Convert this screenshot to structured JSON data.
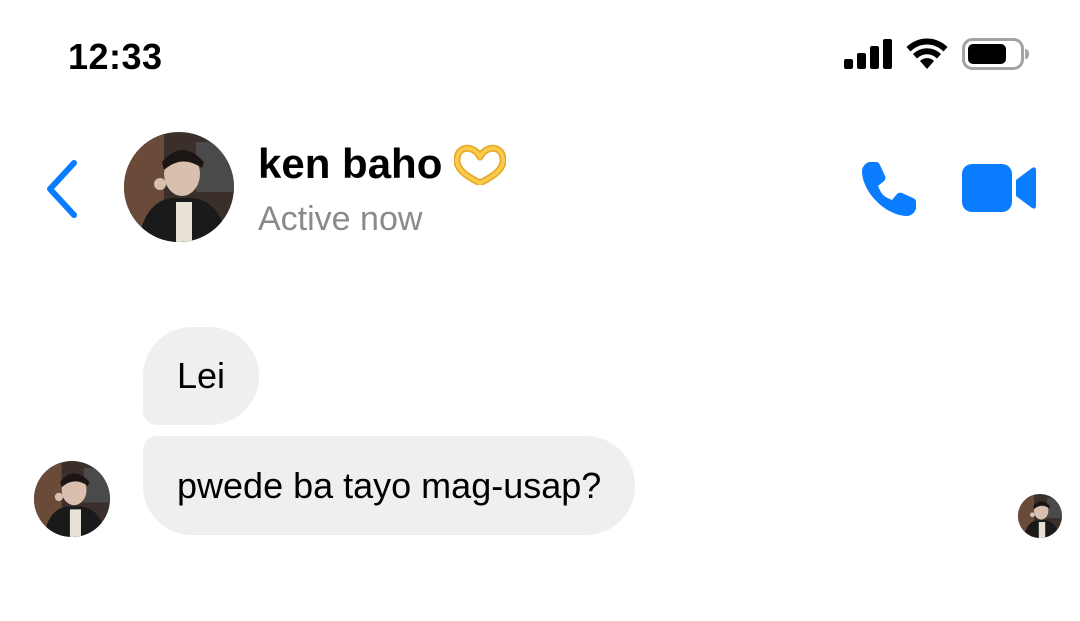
{
  "status_bar": {
    "time": "12:33",
    "icons": [
      "cellular-signal-icon",
      "wifi-icon",
      "battery-icon"
    ]
  },
  "header": {
    "back_icon": "chevron-left-icon",
    "contact_name": "ken baho",
    "name_emoji": "heart-hands-emoji",
    "status": "Active now",
    "actions": [
      "phone-icon",
      "video-camera-icon"
    ]
  },
  "messages": [
    {
      "sender": "ken baho",
      "text": "Lei"
    },
    {
      "sender": "ken baho",
      "text": "pwede ba tayo mag-usap?"
    }
  ],
  "colors": {
    "accent": "#0a7cff",
    "bubble_bg": "#efefef",
    "status_gray": "#8a8a8e"
  }
}
